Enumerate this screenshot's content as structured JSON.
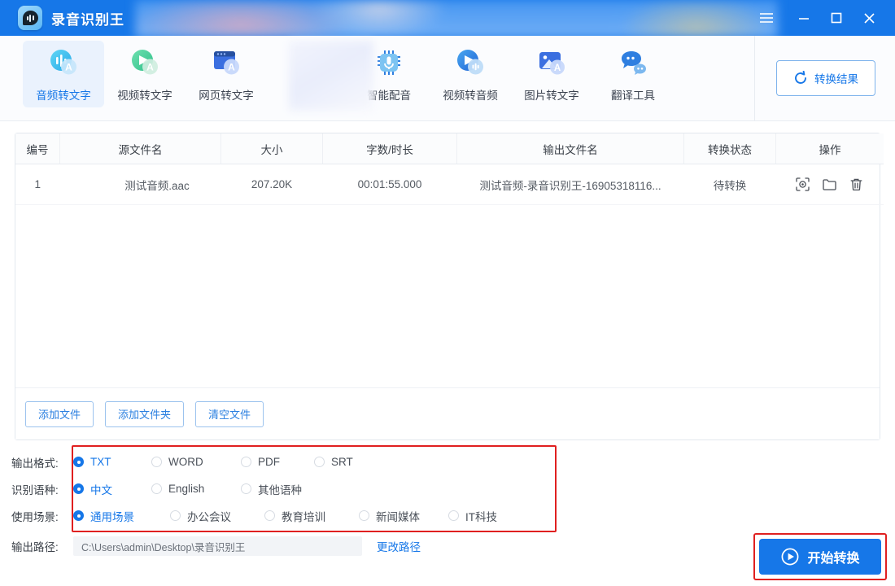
{
  "window": {
    "app_title": "录音识别王",
    "logo_icon": "speech-bubble-audio-icon",
    "controls": [
      {
        "name": "menu",
        "icon": "hamburger-menu-icon"
      },
      {
        "name": "minimize",
        "icon": "minimize-icon"
      },
      {
        "name": "maximize",
        "icon": "maximize-icon"
      },
      {
        "name": "close",
        "icon": "close-icon"
      }
    ]
  },
  "toolbar": {
    "items": [
      {
        "label": "音频转文字",
        "icon": "audio-to-text-icon",
        "active": true
      },
      {
        "label": "视频转文字",
        "icon": "video-to-text-icon",
        "active": false
      },
      {
        "label": "网页转文字",
        "icon": "webpage-to-text-icon",
        "active": false
      },
      {
        "label": "智能配音",
        "icon": "smart-dubbing-icon",
        "active": false
      },
      {
        "label": "视频转音频",
        "icon": "video-to-audio-icon",
        "active": false
      },
      {
        "label": "图片转文字",
        "icon": "image-to-text-icon",
        "active": false
      },
      {
        "label": "翻译工具",
        "icon": "translate-tool-icon",
        "active": false
      }
    ],
    "result_button": {
      "label": "转换结果",
      "icon": "refresh-circle-icon"
    }
  },
  "file_table": {
    "headers": [
      "编号",
      "源文件名",
      "大小",
      "字数/时长",
      "输出文件名",
      "转换状态",
      "操作"
    ],
    "rows": [
      {
        "no": "1",
        "source": "测试音频.aac",
        "size": "207.20K",
        "duration": "00:01:55.000",
        "output": "测试音频-录音识别王-16905318116...",
        "status": "待转换",
        "ops": [
          "preview-icon",
          "folder-icon",
          "delete-icon"
        ]
      }
    ],
    "buttons": [
      {
        "label": "添加文件",
        "name": "add-file-button"
      },
      {
        "label": "添加文件夹",
        "name": "add-folder-button"
      },
      {
        "label": "清空文件",
        "name": "clear-files-button"
      }
    ]
  },
  "options": {
    "format": {
      "label": "输出格式:",
      "choices": [
        {
          "label": "TXT",
          "selected": true
        },
        {
          "label": "WORD",
          "selected": false
        },
        {
          "label": "PDF",
          "selected": false
        },
        {
          "label": "SRT",
          "selected": false
        }
      ]
    },
    "language": {
      "label": "识别语种:",
      "choices": [
        {
          "label": "中文",
          "selected": true
        },
        {
          "label": "English",
          "selected": false
        },
        {
          "label": "其他语种",
          "selected": false
        }
      ]
    },
    "scene": {
      "label": "使用场景:",
      "choices": [
        {
          "label": "通用场景",
          "selected": true
        },
        {
          "label": "办公会议",
          "selected": false
        },
        {
          "label": "教育培训",
          "selected": false
        },
        {
          "label": "新闻媒体",
          "selected": false
        },
        {
          "label": "IT科技",
          "selected": false
        }
      ]
    },
    "highlight_color": "#e02020"
  },
  "output_path": {
    "label": "输出路径:",
    "value": "C:\\Users\\admin\\Desktop\\录音识别王",
    "change_link": "更改路径"
  },
  "start": {
    "label": "开始转换",
    "icon": "play-circle-icon",
    "color": "#1677e8",
    "highlight_color": "#e02020"
  }
}
